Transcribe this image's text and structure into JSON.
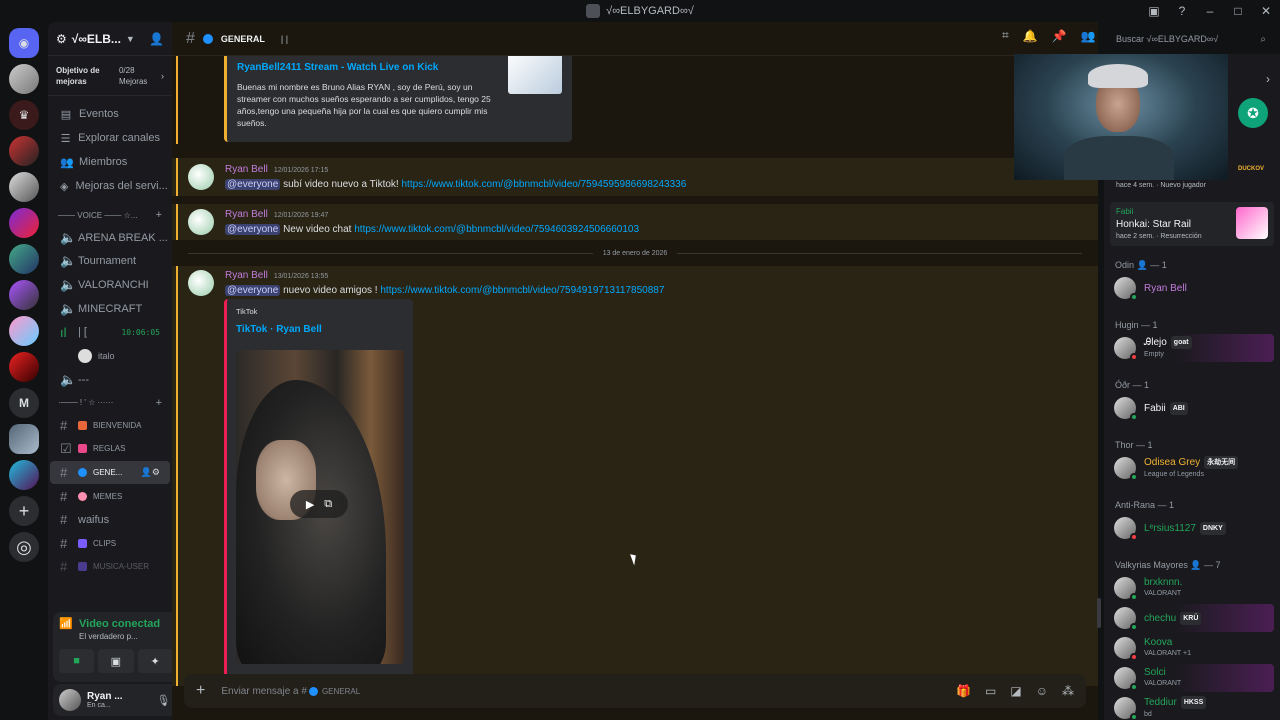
{
  "window": {
    "title": "√∞ELBYGARD∞√"
  },
  "server": {
    "name": "√∞ELB...",
    "goal_label": "Objetivo de mejoras",
    "goal_count": "0/28 Mejoras"
  },
  "nav": [
    {
      "label": "Eventos",
      "icon": "calendar-icon"
    },
    {
      "label": "Explorar canales",
      "icon": "list-icon"
    },
    {
      "label": "Miembros",
      "icon": "members-icon"
    },
    {
      "label": "Mejoras del servi...",
      "icon": "boost-icon"
    }
  ],
  "voice_category": "─── VOICE ─── ☆...",
  "voice_channels": [
    "ARENA BREAK ...",
    "Tournament",
    "VALORANCHI",
    "MINECRAFT"
  ],
  "live_channel": {
    "name": "| [",
    "time": "10:06:05",
    "user": "italo"
  },
  "empty_channel": "---",
  "text_category": "·─── ! ' ☆ ······",
  "text_channels": [
    {
      "name": "BIENVENIDA",
      "color": "#e8673a",
      "small": true
    },
    {
      "name": "REGLAS",
      "color": "#e9498a",
      "small": true
    },
    {
      "name": "GENE...",
      "color": "#1e90ff",
      "small": true,
      "active": true
    },
    {
      "name": "MEMES",
      "color": "#ff8fb1",
      "small": true
    },
    {
      "name": "waifus",
      "color": "",
      "small": false
    },
    {
      "name": "CLIPS",
      "color": "#7b5cff",
      "small": true
    },
    {
      "name": "MUSICA-USER",
      "color": "#7b5cff",
      "small": true
    }
  ],
  "voice_panel": {
    "title": "Video conectad",
    "sub": "El verdadero p..."
  },
  "user": {
    "name": "Ryan ...",
    "status": "En ca..."
  },
  "channel": {
    "name": "GENERAL",
    "pipes": "| |"
  },
  "search": {
    "placeholder": "Buscar √∞ELBYGARD∞√"
  },
  "embed_top": {
    "title": "RyanBell2411 Stream - Watch Live on Kick",
    "desc": "Buenas mi nombre es Bruno Alias RYAN , soy de Perú, soy un streamer con muchos sueños esperando a ser cumplidos, tengo 25 años,tengo una pequeña hija por la cual es que quiero cumplir mis sueños."
  },
  "messages": [
    {
      "author": "Ryan Bell",
      "time": "12/01/2026 17:15",
      "mention": "@everyone",
      "text": "subí video nuevo a Tiktok!",
      "link": "https://www.tiktok.com/@bbnmcbl/video/7594595986698243336"
    },
    {
      "author": "Ryan Bell",
      "time": "12/01/2026 19:47",
      "mention": "@everyone",
      "text": "New video chat",
      "link": "https://www.tiktok.com/@bbnmcbl/video/7594603924506660103"
    },
    {
      "author": "Ryan Bell",
      "time": "13/01/2026 13:55",
      "mention": "@everyone",
      "text": "nuevo video amigos !",
      "link": "https://www.tiktok.com/@bbnmcbl/video/7594919713117850887"
    }
  ],
  "date_separator": "13 de enero de 2026",
  "tiktok_embed": {
    "provider": "TikTok",
    "title": "TikTok · Ryan Bell"
  },
  "composer": {
    "placeholder": "Enviar mensaje a #",
    "channel": "GENERAL"
  },
  "activity": [
    {
      "time": "hace 4 sem.",
      "badge": "Nuevo jugador"
    },
    {
      "who": "Fabii",
      "game": "Honkai: Star Rail",
      "time": "hace 2 sem.",
      "badge": "Resurrección"
    }
  ],
  "green_logo_text": "DUCKOV",
  "roles": [
    {
      "name": "Odin 👤 — 1",
      "members": [
        {
          "name": "Ryan Bell",
          "color": "#c27cda",
          "status": "",
          "tag": ""
        }
      ]
    },
    {
      "name": "Hugin — 1",
      "members": [
        {
          "name": "Ꭿlejo",
          "color": "#f2f3f5",
          "status": "Empty",
          "tag": "goat",
          "boost": true
        }
      ]
    },
    {
      "name": "Óðr — 1",
      "members": [
        {
          "name": "Fabii",
          "color": "#f2f3f5",
          "status": "",
          "tag": "ABI"
        }
      ]
    },
    {
      "name": "Thor — 1",
      "members": [
        {
          "name": "Odisea Grey",
          "color": "#f0b132",
          "status": "League of Legends",
          "tag": "永劫无间"
        }
      ]
    },
    {
      "name": "Anti-Rana — 1",
      "members": [
        {
          "name": "Lᵉrsius1127",
          "color": "#23a55a",
          "status": "",
          "tag": "DNKY"
        }
      ]
    },
    {
      "name": "Valkyrias Mayores 👤 — 7",
      "members": [
        {
          "name": "brxknnn.",
          "color": "#23a55a",
          "status": "VALORANT",
          "tag": ""
        },
        {
          "name": "chechu",
          "color": "#23a55a",
          "status": "",
          "tag": "KRÜ",
          "boost": true
        },
        {
          "name": "Koova",
          "color": "#23a55a",
          "status": "VALORANT +1",
          "tag": ""
        },
        {
          "name": "Solci",
          "color": "#23a55a",
          "status": "VALORANT",
          "tag": "",
          "boost": true
        },
        {
          "name": "Teddiur",
          "color": "#23a55a",
          "status": "bd",
          "tag": "HKSS"
        }
      ]
    }
  ]
}
